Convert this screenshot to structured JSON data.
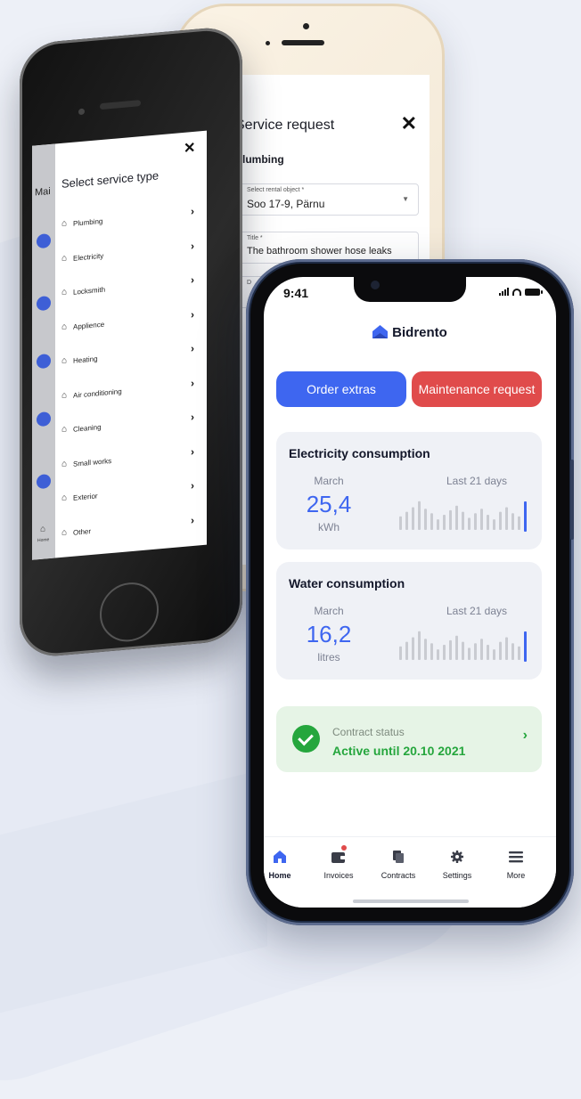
{
  "back_phone": {
    "title": "Service request",
    "close": "✕",
    "category": "Plumbing",
    "fields": [
      {
        "label": "Select rental object *",
        "value": "Soo 17-9, Pärnu",
        "arrow": "▼"
      },
      {
        "label": "Title *",
        "value": "The bathroom shower hose leaks",
        "arrow": ""
      },
      {
        "label": "D",
        "value": "",
        "arrow": ""
      }
    ]
  },
  "left_phone": {
    "side_title": "Mai",
    "title": "Select service type",
    "close": "✕",
    "services": [
      "Plumbing",
      "Electricity",
      "Locksmith",
      "Applience",
      "Heating",
      "Air conditioning",
      "Cleaning",
      "Small works",
      "Exterior",
      "Other"
    ],
    "chevron": "›",
    "nav_home": "Home"
  },
  "status_bar": {
    "time": "9:41"
  },
  "brand": {
    "name": "Bidrento",
    "color": "#3e66f0"
  },
  "buttons": {
    "order_extras": "Order extras",
    "maintenance_request": "Maintenance request"
  },
  "electricity": {
    "title": "Electricity consumption",
    "month": "March",
    "value": "25,4",
    "unit": "kWh",
    "range_label": "Last 21 days",
    "bars": [
      0.45,
      0.6,
      0.75,
      0.95,
      0.7,
      0.55,
      0.35,
      0.5,
      0.65,
      0.8,
      0.6,
      0.4,
      0.55,
      0.7,
      0.5,
      0.35,
      0.6,
      0.75,
      0.55,
      0.45,
      0.9
    ]
  },
  "water": {
    "title": "Water consumption",
    "month": "March",
    "value": "16,2",
    "unit": "litres",
    "range_label": "Last 21 days",
    "bars": [
      0.45,
      0.6,
      0.75,
      0.95,
      0.7,
      0.55,
      0.35,
      0.5,
      0.65,
      0.8,
      0.6,
      0.4,
      0.55,
      0.7,
      0.5,
      0.35,
      0.6,
      0.75,
      0.55,
      0.45,
      0.9
    ]
  },
  "contract": {
    "label": "Contract status",
    "value": "Active until 20.10 2021",
    "color": "#25a63d"
  },
  "tabs": [
    {
      "label": "Home",
      "icon": "home-icon",
      "active": true
    },
    {
      "label": "Invoices",
      "icon": "wallet-icon",
      "badge": true
    },
    {
      "label": "Contracts",
      "icon": "documents-icon"
    },
    {
      "label": "Settings",
      "icon": "gear-icon"
    },
    {
      "label": "More",
      "icon": "menu-icon"
    }
  ],
  "colors": {
    "primary": "#3e66f0",
    "danger": "#e04b4b",
    "success": "#25a63d",
    "bar_inactive": "#c9cbd1"
  }
}
